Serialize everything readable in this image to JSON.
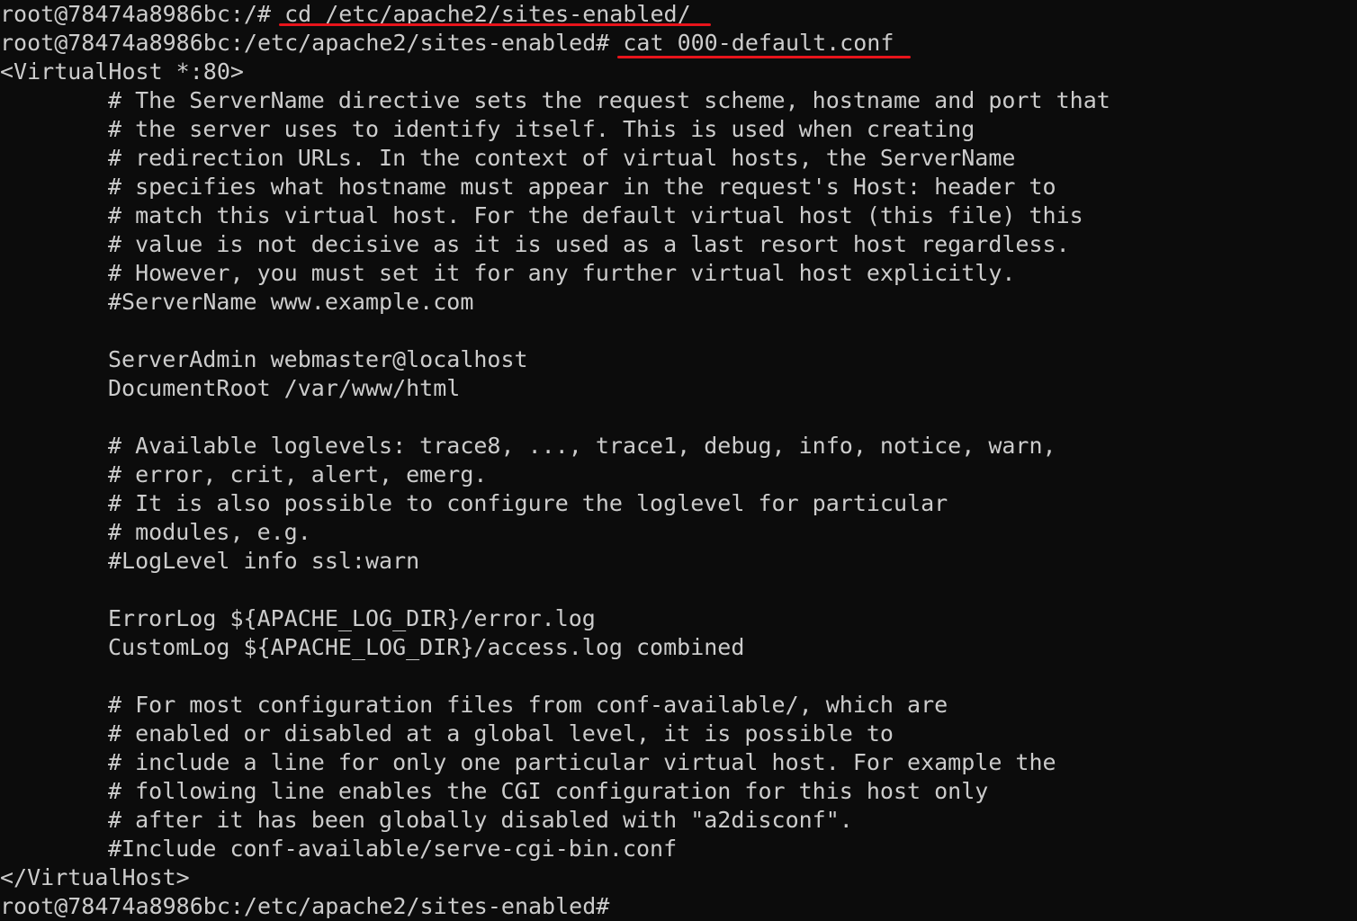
{
  "terminal": {
    "prompt_root": "root@78474a8986bc:/# ",
    "cmd_cd": "cd /etc/apache2/sites-enabled/",
    "prompt_sites": "root@78474a8986bc:/etc/apache2/sites-enabled# ",
    "cmd_cat": "cat 000-default.conf",
    "vhost_open": "<VirtualHost *:80>",
    "body_lines": [
      "# The ServerName directive sets the request scheme, hostname and port that",
      "# the server uses to identify itself. This is used when creating",
      "# redirection URLs. In the context of virtual hosts, the ServerName",
      "# specifies what hostname must appear in the request's Host: header to",
      "# match this virtual host. For the default virtual host (this file) this",
      "# value is not decisive as it is used as a last resort host regardless.",
      "# However, you must set it for any further virtual host explicitly.",
      "#ServerName www.example.com",
      "",
      "ServerAdmin webmaster@localhost",
      "DocumentRoot /var/www/html",
      "",
      "# Available loglevels: trace8, ..., trace1, debug, info, notice, warn,",
      "# error, crit, alert, emerg.",
      "# It is also possible to configure the loglevel for particular",
      "# modules, e.g.",
      "#LogLevel info ssl:warn",
      "",
      "ErrorLog ${APACHE_LOG_DIR}/error.log",
      "CustomLog ${APACHE_LOG_DIR}/access.log combined",
      "",
      "# For most configuration files from conf-available/, which are",
      "# enabled or disabled at a global level, it is possible to",
      "# include a line for only one particular virtual host. For example the",
      "# following line enables the CGI configuration for this host only",
      "# after it has been globally disabled with \"a2disconf\".",
      "#Include conf-available/serve-cgi-bin.conf"
    ],
    "vhost_close": "</VirtualHost>",
    "final_prompt": "root@78474a8986bc:/etc/apache2/sites-enabled#"
  },
  "colors": {
    "background": "#0c0c0c",
    "text": "#cccccc",
    "annotation_underline": "#e8141b"
  }
}
